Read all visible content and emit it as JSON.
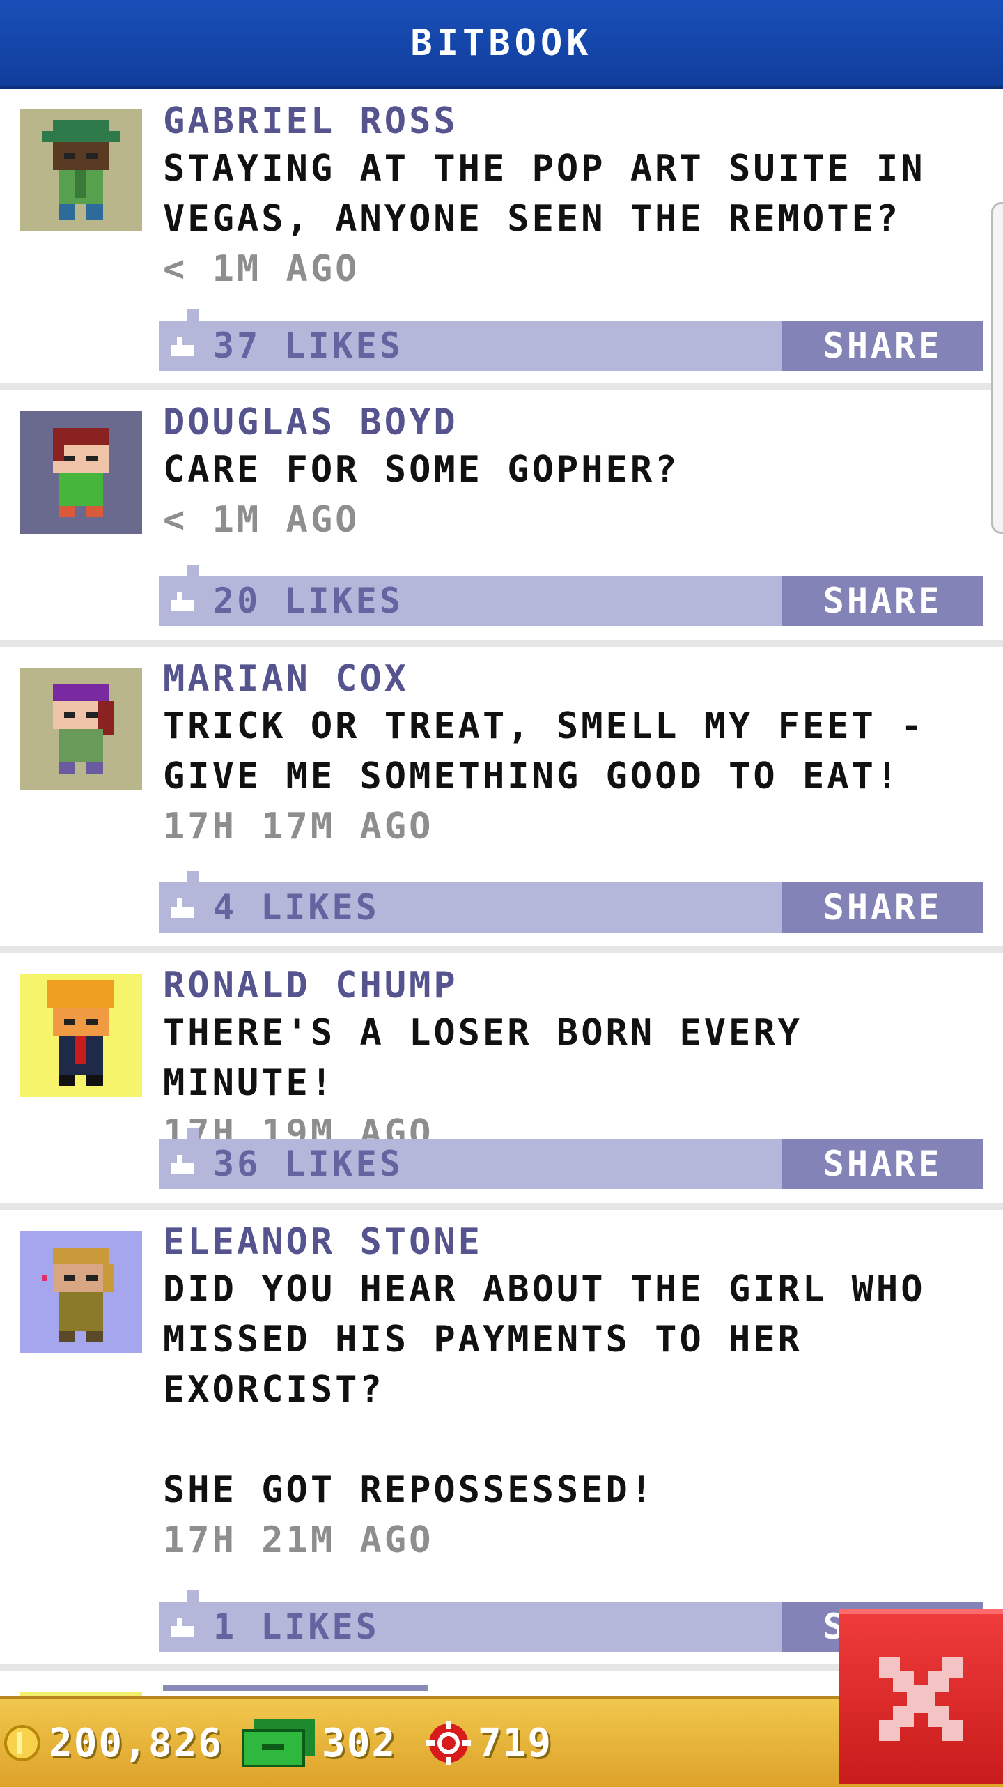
{
  "header": {
    "title": "BITBOOK"
  },
  "posts": [
    {
      "author": "GABRIEL ROSS",
      "message": "STAYING AT THE POP ART SUITE IN VEGAS, ANYONE SEEN THE REMOTE?",
      "time": "< 1M AGO",
      "likes": "37 LIKES",
      "share": "SHARE",
      "avatar_bg": "#b8b68a",
      "avatar_icon": "avatar-green-hat-icon"
    },
    {
      "author": "DOUGLAS BOYD",
      "message": "CARE FOR SOME GOPHER?",
      "time": "< 1M AGO",
      "likes": "20 LIKES",
      "share": "SHARE",
      "avatar_bg": "#6a6a8f",
      "avatar_icon": "avatar-redhead-icon"
    },
    {
      "author": "MARIAN COX",
      "message": "TRICK OR TREAT, SMELL MY FEET - GIVE ME SOMETHING GOOD TO EAT!",
      "time": "17H 17M AGO",
      "likes": "4 LIKES",
      "share": "SHARE",
      "avatar_bg": "#b8b68a",
      "avatar_icon": "avatar-purple-hair-icon"
    },
    {
      "author": "RONALD CHUMP",
      "message": "THERE'S A LOSER BORN EVERY MINUTE!",
      "time": "17H 19M AGO",
      "likes": "36 LIKES",
      "share": "SHARE",
      "avatar_bg": "#f6f46a",
      "avatar_icon": "avatar-blonde-suit-icon"
    },
    {
      "author": "ELEANOR STONE",
      "message": "DID YOU HEAR ABOUT THE GIRL WHO MISSED HIS PAYMENTS TO HER EXORCIST?\n\nSHE GOT REPOSSESSED!",
      "time": "17H 21M AGO",
      "likes": "1 LIKES",
      "share": "SHARE",
      "avatar_bg": "#a6a6ee",
      "avatar_icon": "avatar-blonde-girl-icon"
    }
  ],
  "footer": {
    "coins": "200,826",
    "bux": "302",
    "chips": "719"
  },
  "colors": {
    "header": "#1a4fb8",
    "author": "#55548f",
    "like_bar": "#b5b7da",
    "share": "#8383b7",
    "footer": "#e9b83c",
    "close": "#e02a2a"
  }
}
